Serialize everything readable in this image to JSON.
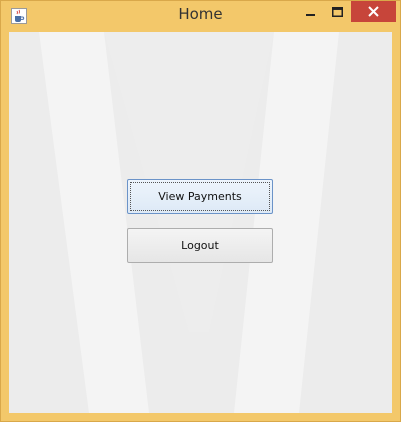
{
  "window": {
    "title": "Home",
    "frame_color": "#f3c86a",
    "close_color": "#c7453a"
  },
  "icons": {
    "app": "java-coffee-cup-icon",
    "minimize": "minimize-icon",
    "maximize": "maximize-icon",
    "close": "close-icon"
  },
  "main": {
    "view_payments_label": "View Payments",
    "logout_label": "Logout"
  }
}
